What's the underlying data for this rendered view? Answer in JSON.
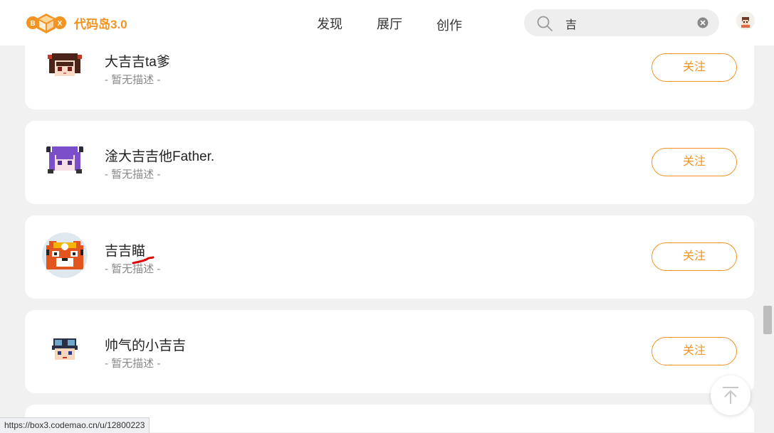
{
  "header": {
    "logo_text": "代码岛3.0",
    "nav": [
      "发现",
      "展厅",
      "创作"
    ],
    "search": {
      "value": "吉",
      "icon": "search-icon",
      "clear_icon": "clear-icon"
    }
  },
  "users": [
    {
      "name": "大吉吉ta爹",
      "desc": "- 暂无描述 -",
      "follow_label": "关注"
    },
    {
      "name": "淦大吉吉他Father.",
      "desc": "- 暂无描述 -",
      "follow_label": "关注"
    },
    {
      "name": "吉吉瞄",
      "desc": "- 暂无描述 -",
      "follow_label": "关注"
    },
    {
      "name": "帅气的小吉吉",
      "desc": "- 暂无描述 -",
      "follow_label": "关注"
    }
  ],
  "status_url": "https://box3.codemao.cn/u/12800223",
  "colors": {
    "accent": "#f29422",
    "background": "#f1f1f1",
    "annotation": "#e00000"
  }
}
